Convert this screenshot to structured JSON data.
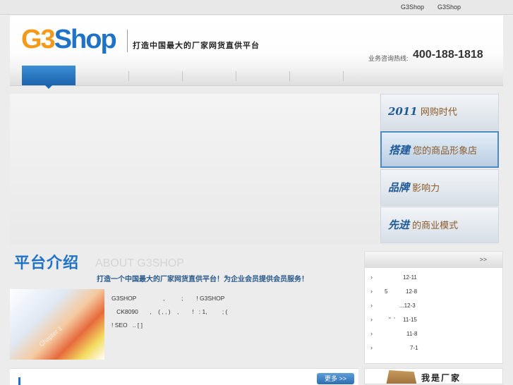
{
  "topbar": {
    "links": [
      "G3Shop",
      "G3Shop"
    ]
  },
  "header": {
    "logo_g3": "G3",
    "logo_shop": "Shop",
    "slogan": "打造中国最大的厂家网货直供平台",
    "hotline_label": "业务咨询热线:",
    "hotline": "400-188-1818"
  },
  "side_menu": {
    "items": [
      {
        "strong": "2011",
        "rest": " 网购时代"
      },
      {
        "strong": "搭建",
        "rest": " 您的商品形象店"
      },
      {
        "strong": "品牌",
        "rest": " 影响力"
      },
      {
        "strong": "先进",
        "rest": " 的商业模式"
      }
    ]
  },
  "intro": {
    "title_cn": "平台介绍",
    "title_en": "ABOUT G3SHOP",
    "subtitle": "打造一个中国最大的厂家网货直供平台！为企业会员提供会员服务！",
    "image_text": "Chapter 1",
    "lines": [
      "G3SHOP                ,          ;        ! G3SHOP",
      "   CK8090       ,    ( , , )    ,        !   : 1,         ; (",
      "! SEO   .. [ ]"
    ],
    "more_label": "更多 >>"
  },
  "news": {
    "more": ">>",
    "rows": [
      {
        "title": "",
        "date": "12-11"
      },
      {
        "title": "5",
        "date": "12-8"
      },
      {
        "title": "",
        "date": "...12-3"
      },
      {
        "title": "\"  '",
        "date": "11-15"
      },
      {
        "title": "",
        "date": "11-8"
      },
      {
        "title": "",
        "date": "7-1"
      }
    ]
  },
  "promo": {
    "text": "我是厂家"
  }
}
